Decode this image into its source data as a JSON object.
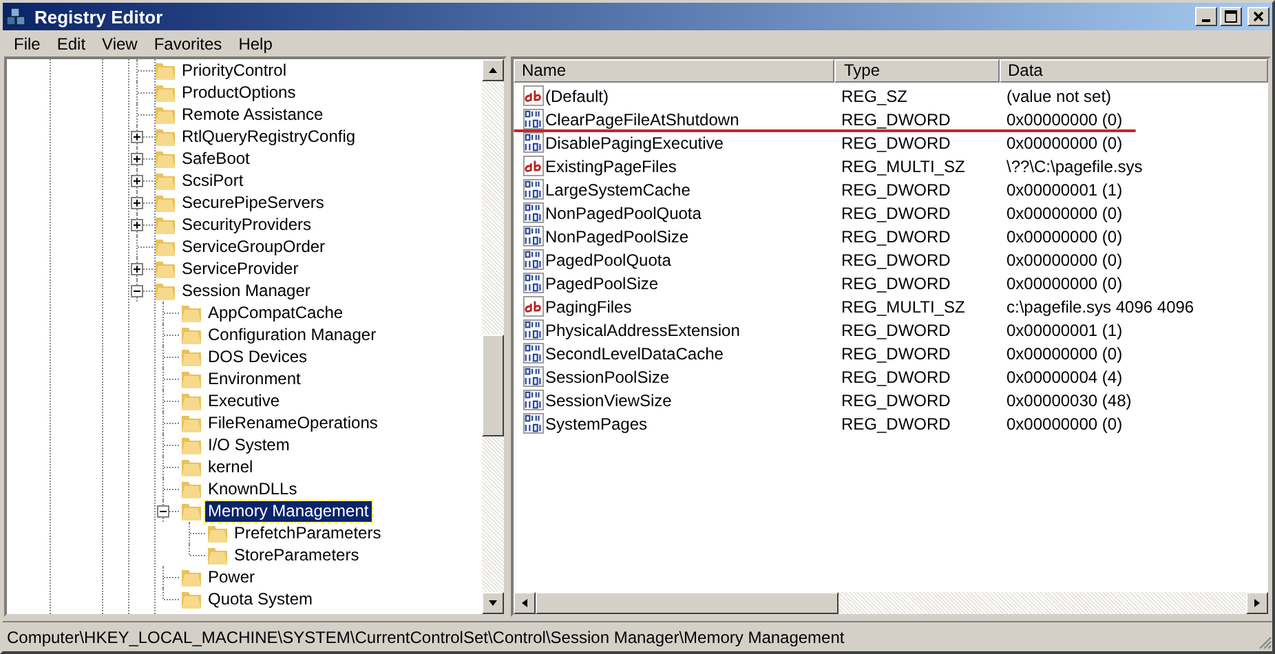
{
  "window": {
    "title": "Registry Editor"
  },
  "menu": [
    "File",
    "Edit",
    "View",
    "Favorites",
    "Help"
  ],
  "tree": [
    {
      "label": "PriorityControl",
      "selected": false
    },
    {
      "label": "ProductOptions",
      "selected": false
    },
    {
      "label": "Remote Assistance",
      "selected": false
    },
    {
      "label": "RtlQueryRegistryConfig",
      "expanded": false,
      "selected": false
    },
    {
      "label": "SafeBoot",
      "expanded": false,
      "selected": false
    },
    {
      "label": "ScsiPort",
      "expanded": false,
      "selected": false
    },
    {
      "label": "SecurePipeServers",
      "expanded": false,
      "selected": false
    },
    {
      "label": "SecurityProviders",
      "expanded": false,
      "selected": false
    },
    {
      "label": "ServiceGroupOrder",
      "selected": false
    },
    {
      "label": "ServiceProvider",
      "expanded": false,
      "selected": false
    },
    {
      "label": "Session Manager",
      "expanded": true,
      "selected": false,
      "children": [
        {
          "label": "AppCompatCache",
          "selected": false
        },
        {
          "label": "Configuration Manager",
          "selected": false
        },
        {
          "label": "DOS Devices",
          "selected": false
        },
        {
          "label": "Environment",
          "selected": false
        },
        {
          "label": "Executive",
          "selected": false
        },
        {
          "label": "FileRenameOperations",
          "selected": false
        },
        {
          "label": "I/O System",
          "selected": false
        },
        {
          "label": "kernel",
          "selected": false
        },
        {
          "label": "KnownDLLs",
          "selected": false
        },
        {
          "label": "Memory Management",
          "expanded": true,
          "selected": true,
          "children": [
            {
              "label": "PrefetchParameters",
              "selected": false
            },
            {
              "label": "StoreParameters",
              "selected": false
            }
          ]
        },
        {
          "label": "Power",
          "selected": false
        },
        {
          "label": "Quota System",
          "selected": false
        }
      ]
    }
  ],
  "table": {
    "columns": [
      "Name",
      "Type",
      "Data"
    ],
    "rows": [
      {
        "kind": "string",
        "name": "(Default)",
        "type": "REG_SZ",
        "data": "(value not set)"
      },
      {
        "kind": "binary",
        "name": "ClearPageFileAtShutdown",
        "type": "REG_DWORD",
        "data": "0x00000000 (0)"
      },
      {
        "kind": "binary",
        "name": "DisablePagingExecutive",
        "type": "REG_DWORD",
        "data": "0x00000000 (0)"
      },
      {
        "kind": "string",
        "name": "ExistingPageFiles",
        "type": "REG_MULTI_SZ",
        "data": "\\??\\C:\\pagefile.sys"
      },
      {
        "kind": "binary",
        "name": "LargeSystemCache",
        "type": "REG_DWORD",
        "data": "0x00000001 (1)"
      },
      {
        "kind": "binary",
        "name": "NonPagedPoolQuota",
        "type": "REG_DWORD",
        "data": "0x00000000 (0)"
      },
      {
        "kind": "binary",
        "name": "NonPagedPoolSize",
        "type": "REG_DWORD",
        "data": "0x00000000 (0)"
      },
      {
        "kind": "binary",
        "name": "PagedPoolQuota",
        "type": "REG_DWORD",
        "data": "0x00000000 (0)"
      },
      {
        "kind": "binary",
        "name": "PagedPoolSize",
        "type": "REG_DWORD",
        "data": "0x00000000 (0)"
      },
      {
        "kind": "string",
        "name": "PagingFiles",
        "type": "REG_MULTI_SZ",
        "data": "c:\\pagefile.sys 4096 4096"
      },
      {
        "kind": "binary",
        "name": "PhysicalAddressExtension",
        "type": "REG_DWORD",
        "data": "0x00000001 (1)"
      },
      {
        "kind": "binary",
        "name": "SecondLevelDataCache",
        "type": "REG_DWORD",
        "data": "0x00000000 (0)"
      },
      {
        "kind": "binary",
        "name": "SessionPoolSize",
        "type": "REG_DWORD",
        "data": "0x00000004 (4)"
      },
      {
        "kind": "binary",
        "name": "SessionViewSize",
        "type": "REG_DWORD",
        "data": "0x00000030 (48)"
      },
      {
        "kind": "binary",
        "name": "SystemPages",
        "type": "REG_DWORD",
        "data": "0x00000000 (0)"
      }
    ]
  },
  "status_bar": "Computer\\HKEY_LOCAL_MACHINE\\SYSTEM\\CurrentControlSet\\Control\\Session Manager\\Memory Management"
}
